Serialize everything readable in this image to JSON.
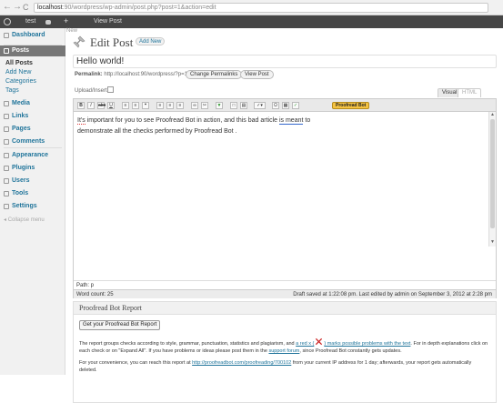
{
  "browser": {
    "url_host": "localhost",
    "url_rest": ":90/wordpress/wp-admin/post.php?post=1&action=edit"
  },
  "adminbar": {
    "site_name": "test",
    "new_label": "+",
    "view_post": "View Post"
  },
  "sidebar": {
    "items": [
      {
        "label": "Dashboard"
      },
      {
        "label": "Posts"
      },
      {
        "label": "Media"
      },
      {
        "label": "Links"
      },
      {
        "label": "Pages"
      },
      {
        "label": "Comments"
      },
      {
        "label": "Appearance"
      },
      {
        "label": "Plugins"
      },
      {
        "label": "Users"
      },
      {
        "label": "Tools"
      },
      {
        "label": "Settings"
      }
    ],
    "sub_items": [
      "All Posts",
      "Add New",
      "Categories",
      "Tags"
    ],
    "collapse": "Collapse menu"
  },
  "main": {
    "help": "New",
    "page_title": "Edit Post",
    "add_new": "Add New",
    "post_title": "Hello world!",
    "permalink_label": "Permalink:",
    "permalink_url": "http://localhost:90/wordpress/?p=1",
    "change_permalinks": "Change Permalinks",
    "view_post": "View Post",
    "upload_insert": "Upload/Insert",
    "tab_visual": "Visual",
    "tab_html": "HTML"
  },
  "editor": {
    "toolbar": [
      "B",
      "I",
      "abc",
      "U",
      "≡",
      "≡",
      "❝",
      "≡",
      "≡",
      "≡",
      "∞",
      "✂",
      "▼",
      "□",
      "▤",
      "✓▾",
      "Ω",
      "▦",
      "✓"
    ],
    "proofread_button": "Proofread Bot",
    "line1_a": "It's",
    "line1_b": " important for you to see Proofread Bot in action, and this bad article ",
    "line1_c": "is meant",
    "line1_d": " to",
    "line2": "demonstrate all the checks performed by Proofread Bot .",
    "path": "Path: p",
    "word_count": "Word count: 25",
    "draft_status": "Draft saved at 1:22:08 pm. Last edited by admin on September 3, 2012 at 2:28 pm"
  },
  "report": {
    "heading": "Proofread Bot Report",
    "button": "Get your Proofread Bot Report",
    "p1_a": "The report groups checks according to style, grammar, punctuation, statistics and plagiarism, and ",
    "p1_link1": "a red x (",
    "p1_link2": ") marks possible problems with the text",
    "p1_b": ". For in depth explanations click on each check or on \"Expand All\". If you have problems or ideas please post them in the ",
    "p1_link3": "support forum",
    "p1_c": ", since Proofread Bot constantly gets updates.",
    "p2_a": "For your convenience, you can reach this report at ",
    "p2_link": "http://proofreadbot.com/proofreading/700102",
    "p2_b": " from your current IP address for 1 day; afterwards, your report gets automatically deleted."
  },
  "colors": {
    "accent": "#21759b",
    "adminbar": "#464646",
    "active_menu": "#777777",
    "proofread_button": "#f5c342",
    "red_x": "#cc2222"
  }
}
